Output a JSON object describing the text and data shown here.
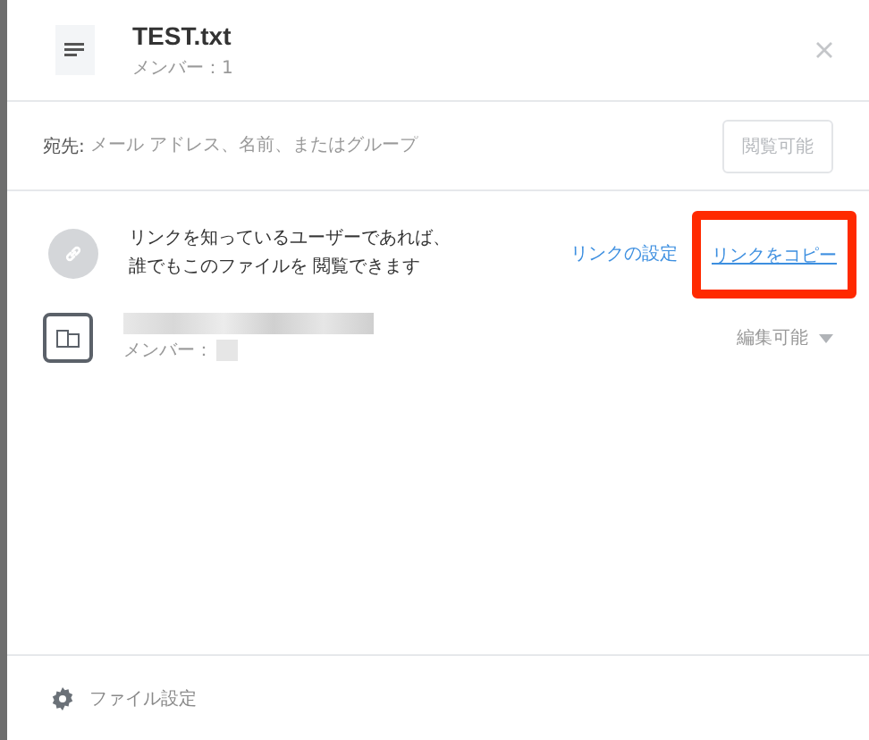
{
  "header": {
    "title": "TEST.txt",
    "subtitle": "メンバー：1"
  },
  "recipient": {
    "label": "宛先:",
    "placeholder": "メール アドレス、名前、またはグループ",
    "permission_button": {
      "label": "閲覧可能",
      "disabled": true
    }
  },
  "link_section": {
    "description": "リンクを知っているユーザーであれば、誰でもこのファイルを 閲覧できます",
    "links": [
      {
        "label": "リンクの設定",
        "highlighted": false
      },
      {
        "label": "リンクをコピー",
        "highlighted": true
      }
    ]
  },
  "members": [
    {
      "subtitle": "メンバー：",
      "permission": "編集可能"
    }
  ],
  "footer": {
    "label": "ファイル設定"
  }
}
